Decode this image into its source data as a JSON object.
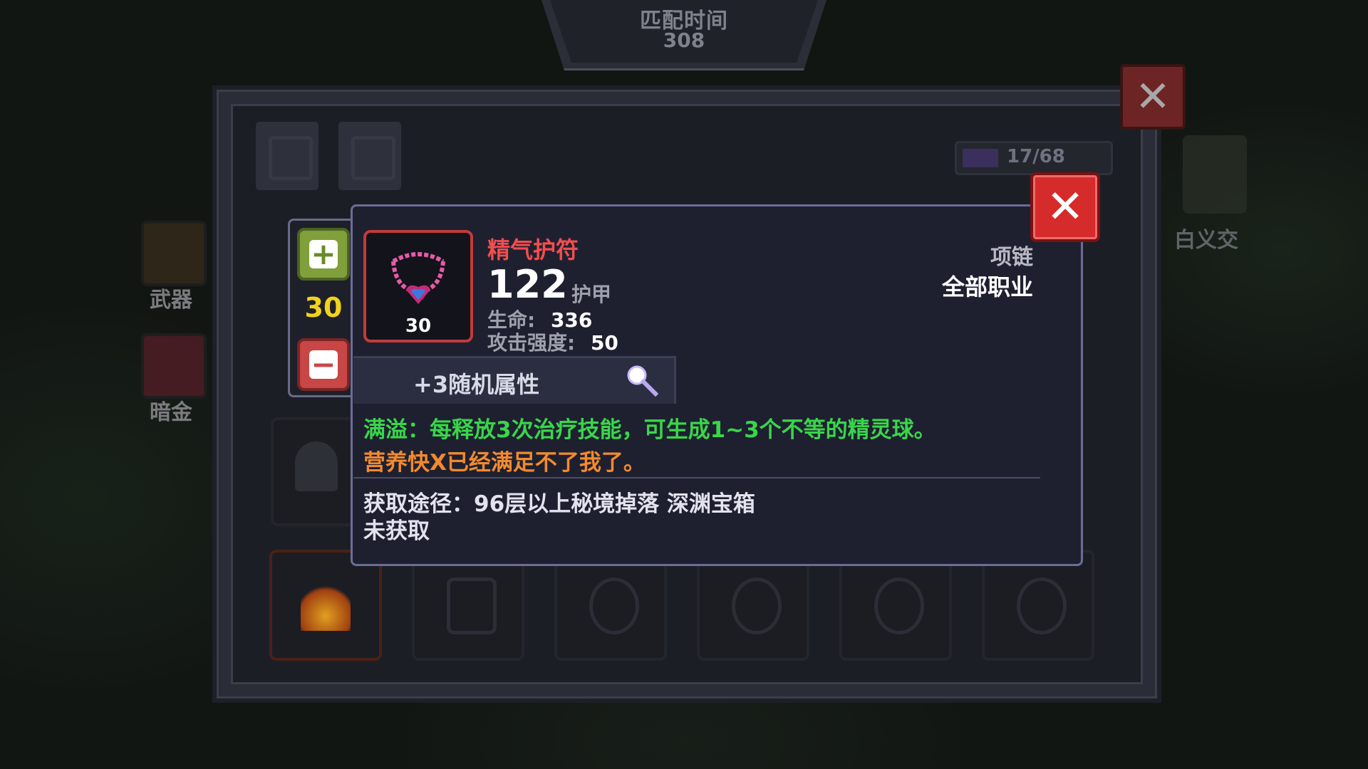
{
  "match_timer": {
    "label": "匹配时间",
    "value": "308"
  },
  "inventory": {
    "counter": "17/68",
    "side_slots": [
      {
        "label": "武器"
      },
      {
        "label": "暗金"
      }
    ],
    "character_name": "白义交"
  },
  "stepper": {
    "value": "30"
  },
  "item": {
    "name": "精气护符",
    "level": "30",
    "armor_value": "122",
    "armor_label": "护甲",
    "stats": [
      {
        "key": "生命:",
        "value": "336"
      },
      {
        "key": "攻击强度:",
        "value": "50"
      }
    ],
    "slot_type": "项链",
    "class_restriction": "全部职业",
    "random_attributes": "+3随机属性",
    "passive": "满溢：每释放3次治疗技能，可生成1~3个不等的精灵球。",
    "flavor": "营养快X已经满足不了我了。",
    "source": "获取途径：96层以上秘境掉落 深渊宝箱",
    "obtained_status": "未获取"
  },
  "colors": {
    "item_name": "#f24e4e",
    "passive": "#39d64a",
    "flavor": "#f28a2e",
    "stepper_value": "#f2d21c",
    "close_button": "#d62b2b"
  }
}
